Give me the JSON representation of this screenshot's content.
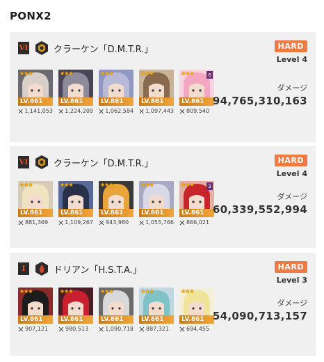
{
  "page": {
    "title": "PONX2"
  },
  "colors": {
    "hard_badge": "#f07a43",
    "level_bar": "#f0a53a",
    "star": "#f7b300",
    "rank_text": "#e8541e"
  },
  "runs": [
    {
      "rank": "VI",
      "element_icon": "iron-element-icon",
      "element_color": "#d89a1a",
      "boss": "クラーケン「D.M.T.R.」",
      "difficulty": "HARD",
      "level": "Level 4",
      "damage_label": "ダメージ",
      "damage": "94,765,310,163",
      "units": [
        {
          "lv": "LV.861",
          "power": "1,141,053",
          "stars": "★★★",
          "burst": "",
          "hair": "#d8cfc9",
          "bg": "#6b6a70"
        },
        {
          "lv": "LV.861",
          "power": "1,224,209",
          "stars": "★★★",
          "burst": "",
          "hair": "#8d8a9a",
          "bg": "#4a4458"
        },
        {
          "lv": "LV.861",
          "power": "1,062,584",
          "stars": "★★★",
          "burst": "",
          "hair": "#b8b9d6",
          "bg": "#8f97c2"
        },
        {
          "lv": "LV.861",
          "power": "1,097,443",
          "stars": "★★★",
          "burst": "",
          "hair": "#8a6a4e",
          "bg": "#c9b49a"
        },
        {
          "lv": "LV.861",
          "power": "809,540",
          "stars": "★★★",
          "burst": "6",
          "hair": "#f2a6c1",
          "bg": "#f6d3df"
        }
      ]
    },
    {
      "rank": "VI",
      "element_icon": "iron-element-icon",
      "element_color": "#d89a1a",
      "boss": "クラーケン「D.M.T.R.」",
      "difficulty": "HARD",
      "level": "Level 4",
      "damage_label": "ダメージ",
      "damage": "60,339,552,994",
      "units": [
        {
          "lv": "LV.861",
          "power": "881,369",
          "stars": "★★★",
          "burst": "",
          "hair": "#efe3c0",
          "bg": "#d6ccb8"
        },
        {
          "lv": "LV.861",
          "power": "1,109,267",
          "stars": "★★★",
          "burst": "",
          "hair": "#28304a",
          "bg": "#5a6a96"
        },
        {
          "lv": "LV.861",
          "power": "943,980",
          "stars": "★★★",
          "burst": "",
          "hair": "#e9a53a",
          "bg": "#3a3a3a"
        },
        {
          "lv": "LV.861",
          "power": "1,055,766",
          "stars": "★★★",
          "burst": "",
          "hair": "#d9d8e6",
          "bg": "#a8aac4"
        },
        {
          "lv": "LV.861",
          "power": "866,021",
          "stars": "★★★",
          "burst": "3",
          "hair": "#c8242c",
          "bg": "#e4b0a6"
        }
      ]
    },
    {
      "rank": "I",
      "element_icon": "fire-element-icon",
      "element_color": "#d8412a",
      "boss": "ドリアン「H.S.T.A.」",
      "difficulty": "HARD",
      "level": "Level 3",
      "damage_label": "ダメージ",
      "damage": "54,090,713,157",
      "units": [
        {
          "lv": "LV.861",
          "power": "907,121",
          "stars": "★★★",
          "burst": "",
          "hair": "#1c1c1c",
          "bg": "#8a2a2a"
        },
        {
          "lv": "LV.861",
          "power": "980,513",
          "stars": "★★★",
          "burst": "",
          "hair": "#c92030",
          "bg": "#4a1e22"
        },
        {
          "lv": "LV.861",
          "power": "1,090,718",
          "stars": "★★★",
          "burst": "",
          "hair": "#d9d9d9",
          "bg": "#6a6a6a"
        },
        {
          "lv": "LV.861",
          "power": "887,321",
          "stars": "★★★",
          "burst": "",
          "hair": "#7fc3c6",
          "bg": "#bfd8e0"
        },
        {
          "lv": "LV.861",
          "power": "694,455",
          "stars": "★★★",
          "burst": "",
          "hair": "#f0e39a",
          "bg": "#f3efd8"
        }
      ]
    }
  ]
}
